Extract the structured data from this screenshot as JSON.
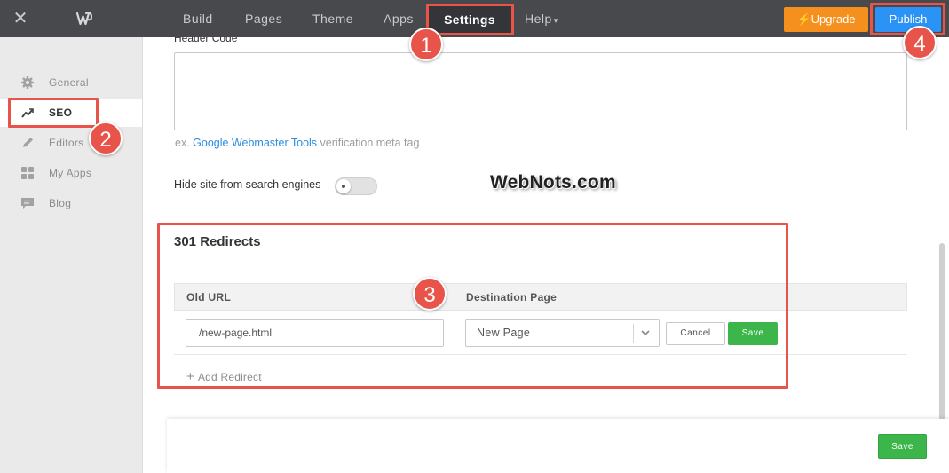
{
  "topbar": {
    "close_glyph": "✕",
    "logo_icon": "weebly-logo-icon",
    "nav": [
      "Build",
      "Pages",
      "Theme",
      "Apps",
      "Settings",
      "Help"
    ],
    "help_caret": "▾",
    "upgrade_label": "Upgrade",
    "upgrade_icon": "lightning-icon",
    "publish_label": "Publish",
    "bg_color": "#47494d",
    "upgrade_color": "#f5901e",
    "publish_color": "#2b93f5"
  },
  "sidebar": {
    "items": [
      {
        "label": "General",
        "icon": "gear-icon",
        "active": false
      },
      {
        "label": "SEO",
        "icon": "trend-icon",
        "active": true
      },
      {
        "label": "Editors",
        "icon": "pencil-icon",
        "active": false
      },
      {
        "label": "My Apps",
        "icon": "grid-icon",
        "active": false
      },
      {
        "label": "Blog",
        "icon": "chat-icon",
        "active": false
      }
    ]
  },
  "main": {
    "header_code_label": "Header Code",
    "header_code_value": "",
    "hint_prefix": "ex.",
    "hint_link": "Google Webmaster Tools",
    "hint_suffix": "verification meta tag",
    "hide_label": "Hide site from search engines",
    "hide_enabled": false,
    "watermark": "WebNots.com",
    "redirects_title": "301 Redirects",
    "col_old": "Old URL",
    "col_dest": "Destination Page",
    "old_url_value": "/new-page.html",
    "dest_value": "New Page",
    "cancel_label": "Cancel",
    "save_label": "Save",
    "add_redirect_label": "Add Redirect",
    "footer_save_label": "Save",
    "save_color": "#3cb54a"
  },
  "annotations": {
    "badges": [
      "1",
      "2",
      "3",
      "4"
    ],
    "color": "#e8534a"
  }
}
